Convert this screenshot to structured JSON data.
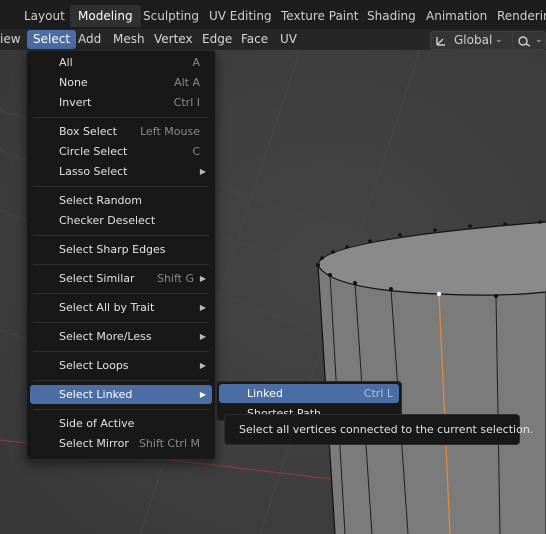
{
  "workspace_tabs": [
    "Layout",
    "Modeling",
    "Sculpting",
    "UV Editing",
    "Texture Paint",
    "Shading",
    "Animation",
    "Rendering"
  ],
  "active_tab": "Modeling",
  "header_menus": [
    "iew",
    "Select",
    "Add",
    "Mesh",
    "Vertex",
    "Edge",
    "Face",
    "UV"
  ],
  "active_menu": "Select",
  "orientation": {
    "label": "Global",
    "icon": "transform-orientation-icon"
  },
  "snap_icon": "link-icon",
  "select_menu": {
    "items": [
      {
        "label": "All",
        "shortcut": "A"
      },
      {
        "label": "None",
        "shortcut": "Alt A"
      },
      {
        "label": "Invert",
        "shortcut": "Ctrl I"
      },
      {
        "label": "Box Select",
        "shortcut": "Left Mouse"
      },
      {
        "label": "Circle Select",
        "shortcut": "C"
      },
      {
        "label": "Lasso Select",
        "shortcut": "",
        "submenu": true
      },
      {
        "label": "Select Random",
        "shortcut": ""
      },
      {
        "label": "Checker Deselect",
        "shortcut": ""
      },
      {
        "label": "Select Sharp Edges",
        "shortcut": ""
      },
      {
        "label": "Select Similar",
        "shortcut": "Shift G",
        "submenu": true
      },
      {
        "label": "Select All by Trait",
        "shortcut": "",
        "submenu": true
      },
      {
        "label": "Select More/Less",
        "shortcut": "",
        "submenu": true
      },
      {
        "label": "Select Loops",
        "shortcut": "",
        "submenu": true
      },
      {
        "label": "Select Linked",
        "shortcut": "",
        "submenu": true,
        "highlighted": true
      },
      {
        "label": "Side of Active",
        "shortcut": ""
      },
      {
        "label": "Select Mirror",
        "shortcut": "Shift Ctrl M"
      }
    ]
  },
  "linked_submenu": {
    "items": [
      {
        "label": "Linked",
        "shortcut": "Ctrl L",
        "highlighted": true
      },
      {
        "label": "Shortest Path",
        "shortcut": ""
      }
    ]
  },
  "tooltip": "Select all vertices connected to the current selection.",
  "colors": {
    "accent": "#4b6da4",
    "menu_bg": "#181818",
    "viewport_bg": "#3d3d3d",
    "selected_edge": "#e08a3c",
    "x_axis": "#8b3a3a"
  }
}
